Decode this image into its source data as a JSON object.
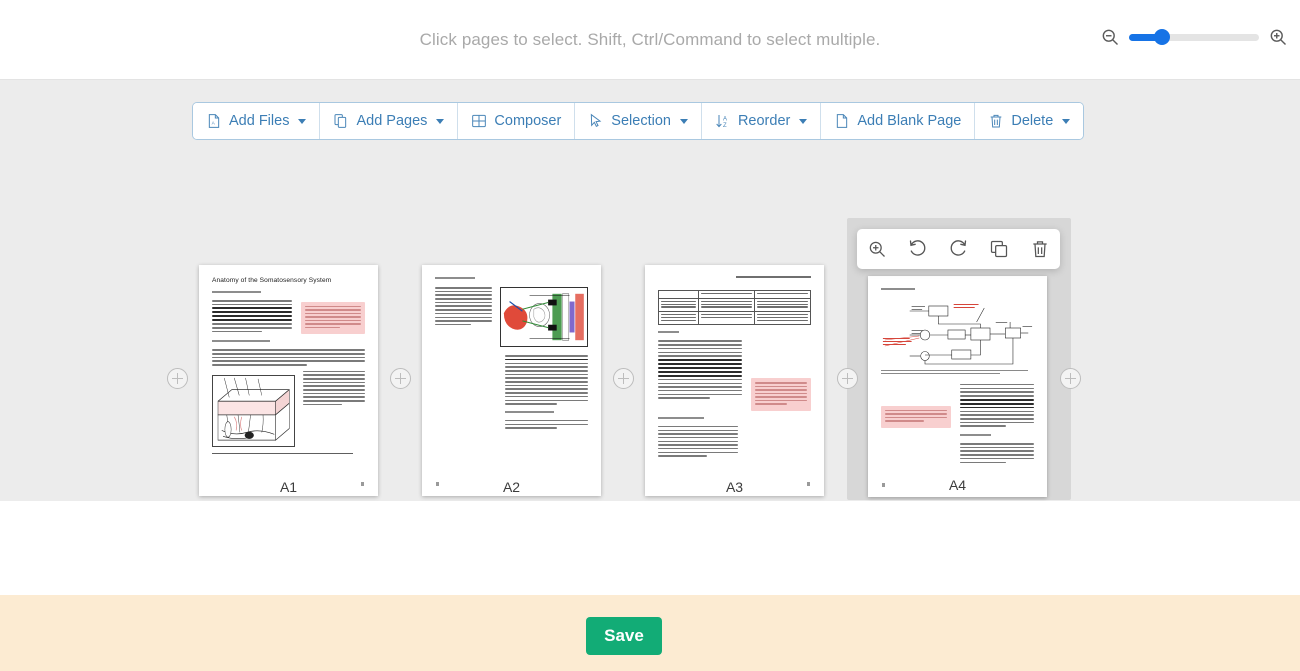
{
  "header": {
    "hint": "Click pages to select. Shift, Ctrl/Command to select multiple.",
    "zoom_out_icon": "zoom-out-icon",
    "zoom_in_icon": "zoom-in-icon",
    "zoom_slider_percent": 25
  },
  "toolbar": {
    "buttons": [
      {
        "label": "Add Files",
        "icon": "pdf-file-icon",
        "has_caret": true
      },
      {
        "label": "Add Pages",
        "icon": "copy-pages-icon",
        "has_caret": true
      },
      {
        "label": "Composer",
        "icon": "grid-composer-icon",
        "has_caret": false
      },
      {
        "label": "Selection",
        "icon": "cursor-arrow-icon",
        "has_caret": true
      },
      {
        "label": "Reorder",
        "icon": "sort-az-icon",
        "has_caret": true
      },
      {
        "label": "Add Blank Page",
        "icon": "blank-page-icon",
        "has_caret": false
      },
      {
        "label": "Delete",
        "icon": "trash-icon",
        "has_caret": true
      }
    ]
  },
  "pages": [
    {
      "label": "A1",
      "selected": false,
      "title": "Anatomy of the Somatosensory System"
    },
    {
      "label": "A2",
      "selected": false,
      "title": ""
    },
    {
      "label": "A3",
      "selected": false,
      "title": ""
    },
    {
      "label": "A4",
      "selected": true,
      "title": ""
    }
  ],
  "page_tools": {
    "buttons": [
      {
        "name": "zoom-preview",
        "icon": "zoom-in-icon"
      },
      {
        "name": "rotate-left",
        "icon": "rotate-left-icon"
      },
      {
        "name": "rotate-right",
        "icon": "rotate-right-icon"
      },
      {
        "name": "duplicate",
        "icon": "duplicate-icon"
      },
      {
        "name": "delete",
        "icon": "trash-icon"
      }
    ]
  },
  "insert_buttons": {
    "count": 5,
    "icon": "plus-circle-icon"
  },
  "footer": {
    "save_label": "Save"
  },
  "colors": {
    "accent_blue": "#3c7eb5",
    "slider_blue": "#1673e6",
    "save_green": "#12ac76",
    "footer_cream": "#fcebd2",
    "workarea_gray": "#ececec",
    "selected_gray": "#d7d7d7",
    "highlight_pink": "#f8cfcf"
  }
}
